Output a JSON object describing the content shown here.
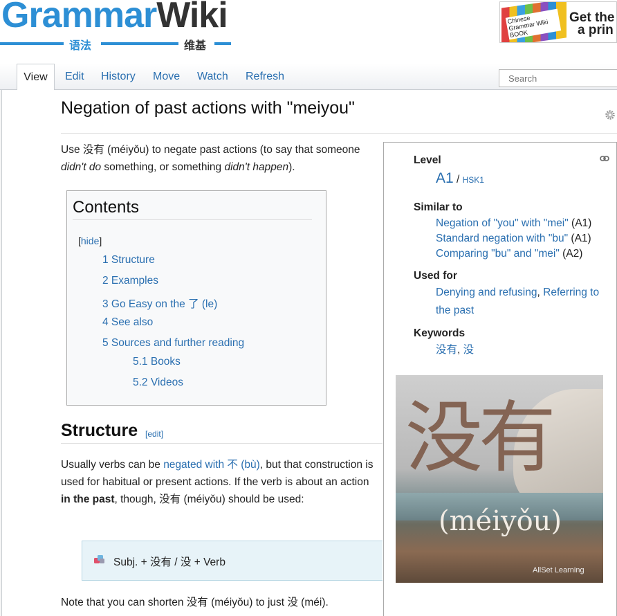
{
  "header": {
    "logo_grammar": "Grammar",
    "logo_wiki": "Wiki",
    "logo_sub_cn1": "语法",
    "logo_sub_cn2": "维基",
    "ad_book_label": "Chinese Grammar Wiki BOOK",
    "ad_text_line1": "Get the",
    "ad_text_line2": "a prin"
  },
  "tabs": [
    {
      "label": "View"
    },
    {
      "label": "Edit"
    },
    {
      "label": "History"
    },
    {
      "label": "Move"
    },
    {
      "label": "Watch"
    },
    {
      "label": "Refresh"
    }
  ],
  "search": {
    "placeholder": "Search"
  },
  "page": {
    "title": "Negation of past actions with \"meiyou\"",
    "intro": {
      "t1": "Use 没有 (méiyǒu) to negate past actions (to say that someone ",
      "em1": "didn't do",
      "t2": " something, or something ",
      "em2": "didn't happen",
      "t3": ")."
    }
  },
  "toc": {
    "title": "Contents",
    "hide_open": "[",
    "hide_label": "hide",
    "hide_close": "]",
    "items": [
      {
        "label": "1 Structure"
      },
      {
        "label": "2 Examples"
      },
      {
        "label": "3 Go Easy on the 了 (le)"
      },
      {
        "label": "4 See also"
      },
      {
        "label": "5 Sources and further reading"
      },
      {
        "label": "5.1 Books"
      },
      {
        "label": "5.2 Videos"
      }
    ]
  },
  "infobox": {
    "level_heading": "Level",
    "level_value": "A1",
    "level_sep": " / ",
    "level_hsk": "HSK1",
    "similar_heading": "Similar to",
    "similar": [
      {
        "label": "Negation of \"you\" with \"mei\"",
        "level": " (A1)"
      },
      {
        "label": "Standard negation with \"bu\"",
        "level": " (A1)"
      },
      {
        "label": "Comparing \"bu\" and \"mei\"",
        "level": " (A2)"
      }
    ],
    "used_heading": "Used for",
    "used_1": "Denying and refusing",
    "used_sep": ", ",
    "used_2a": "Referring to",
    "used_2b": "the past",
    "keywords_heading": "Keywords",
    "kw_1": "没有",
    "kw_sep": ", ",
    "kw_2": "没",
    "image_glyph": "没有",
    "image_pinyin": "(méiyǒu)",
    "image_credit": "AllSet Learning"
  },
  "structure": {
    "heading": "Structure",
    "edit_label": "edit",
    "p_t1": "Usually verbs can be ",
    "p_link": "negated with 不 (bù)",
    "p_t2": ", but that construction is used for habitual or present actions. If the verb is about an action ",
    "p_bold": "in the past",
    "p_t3": ", though, 没有 (méiyǒu) should be used:",
    "pattern": "Subj. + 没有 / 没 + Verb",
    "note": "Note that you can shorten 没有 (méiyǒu) to just 没 (méi)."
  },
  "colors": {
    "brand_blue": "#2d8fd5",
    "link": "#2a6fb0",
    "pattern_bg": "#e7f3f8"
  }
}
